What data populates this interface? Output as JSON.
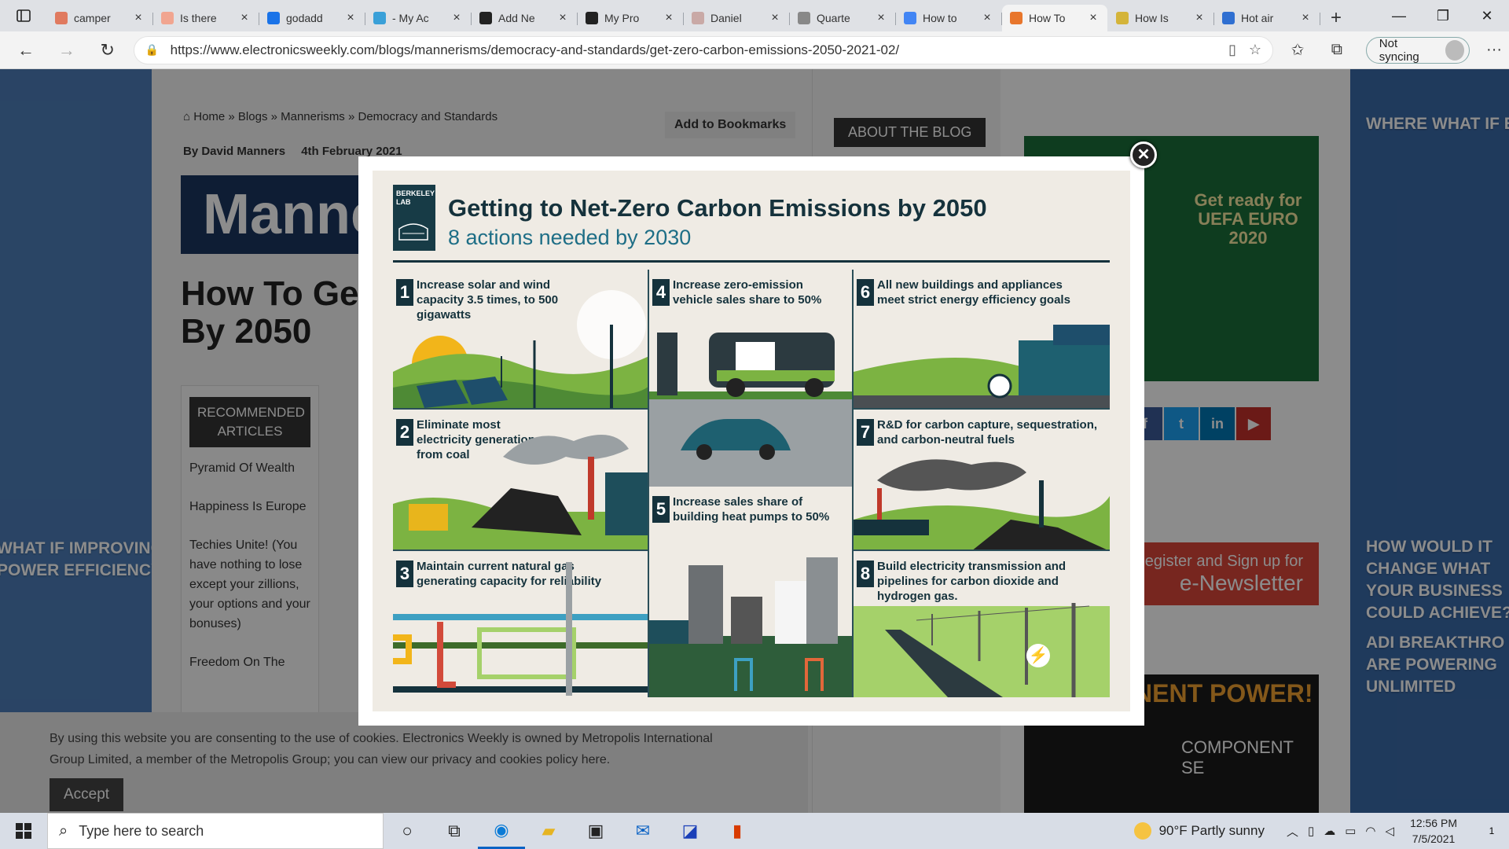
{
  "browser": {
    "tabs": [
      {
        "label": "camper",
        "color": "#e07a5f",
        "active": false
      },
      {
        "label": "Is there",
        "color": "#f1a590",
        "active": false
      },
      {
        "label": "godadd",
        "color": "#1a73e8",
        "active": false
      },
      {
        "label": "- My Ac",
        "color": "#3aa0d8",
        "active": false
      },
      {
        "label": "Add Ne",
        "color": "#222222",
        "active": false
      },
      {
        "label": "My Pro",
        "color": "#222222",
        "active": false
      },
      {
        "label": "Daniel",
        "color": "#c9a9a6",
        "active": false
      },
      {
        "label": "Quarte",
        "color": "#888888",
        "active": false
      },
      {
        "label": "How to",
        "color": "#4285f4",
        "active": false
      },
      {
        "label": "How To",
        "color": "#e8762c",
        "active": true
      },
      {
        "label": "How Is",
        "color": "#d4b43a",
        "active": false
      },
      {
        "label": "Hot air",
        "color": "#2f6fd1",
        "active": false
      }
    ],
    "url": "https://www.electronicsweekly.com/blogs/mannerisms/democracy-and-standards/get-zero-carbon-emissions-2050-2021-02/",
    "sync_label": "Not syncing"
  },
  "page": {
    "breadcrumb": "Home » Blogs » Mannerisms » Democracy and Standards",
    "bookmark_label": "Add to Bookmarks",
    "author": "By David Manners",
    "date": "4th February 2021",
    "banner": "Manne",
    "headline_line1": "How To Get",
    "headline_line2": "By 2050",
    "recommended_title": "RECOMMENDED ARTICLES",
    "recommended": [
      "Pyramid Of Wealth",
      "Happiness Is Europe",
      "Techies Unite! (You have nothing to lose except your zillions, your options and your bonuses)",
      "Freedom On The"
    ],
    "about_label": "ABOUT THE BLOG",
    "ad_text": "Get ready for UEFA EURO 2020",
    "newsletter_line1": "Register and Sign up for",
    "newsletter_line2": "e-Newsletter",
    "power_text": "NENT POWER!",
    "component_text": "COMPONENT SE",
    "side_left_top": "WHAT IF IMPROVING",
    "side_left_bottom": "POWER EFFICIENCY",
    "side_right_top": "WHERE WHAT IF E",
    "side_right_q1": "HOW WOULD IT",
    "side_right_q2": "CHANGE WHAT",
    "side_right_q3": "YOUR BUSINESS",
    "side_right_q4": "COULD ACHIEVE?",
    "side_right_q5": "ADI BREAKTHRO",
    "side_right_q6": "ARE POWERING",
    "side_right_q7": "UNLIMITED"
  },
  "cookie": {
    "text": "By using this website you are consenting to the use of cookies. Electronics Weekly is owned by Metropolis International Group Limited, a member of the Metropolis Group; you can view our privacy and cookies policy here.",
    "accept_label": "Accept"
  },
  "infographic": {
    "logo": "BERKELEY LAB",
    "title": "Getting to Net-Zero Carbon Emissions by 2050",
    "subtitle": "8 actions needed by 2030",
    "actions": [
      {
        "n": "1",
        "text": "Increase solar and wind capacity 3.5 times, to 500 gigawatts"
      },
      {
        "n": "2",
        "text": "Eliminate most electricity generation from coal"
      },
      {
        "n": "3",
        "text": "Maintain current natural gas generating capacity for reliability"
      },
      {
        "n": "4",
        "text": "Increase zero-emission vehicle sales share to 50%"
      },
      {
        "n": "5",
        "text": "Increase sales share of building heat pumps to 50%"
      },
      {
        "n": "6",
        "text": "All new buildings and appliances meet strict energy efficiency goals"
      },
      {
        "n": "7",
        "text": "R&D for carbon capture, sequestration, and carbon-neutral fuels"
      },
      {
        "n": "8",
        "text": "Build electricity transmission and pipelines for carbon dioxide and hydrogen gas."
      }
    ]
  },
  "taskbar": {
    "search_placeholder": "Type here to search",
    "weather": "90°F  Partly sunny",
    "time": "12:56 PM",
    "date": "7/5/2021",
    "notifications": "1"
  }
}
